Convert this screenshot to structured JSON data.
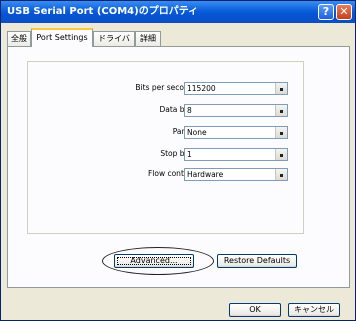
{
  "window": {
    "title": "USB Serial Port (COM4)のプロパティ",
    "help_icon": "?",
    "close_icon": "✕"
  },
  "tabs": [
    {
      "label": "全般"
    },
    {
      "label": "Port Settings"
    },
    {
      "label": "ドライバ"
    },
    {
      "label": "詳細"
    }
  ],
  "settings": [
    {
      "label": "Bits per second:",
      "value": "115200"
    },
    {
      "label": "Data bits:",
      "value": "8"
    },
    {
      "label": "Parity:",
      "value": "None"
    },
    {
      "label": "Stop bits:",
      "value": "1"
    },
    {
      "label": "Flow control:",
      "value": "Hardware"
    }
  ],
  "buttons": {
    "advanced": "Advanced...",
    "restore_defaults": "Restore Defaults",
    "ok": "OK",
    "cancel": "キャンセル"
  }
}
